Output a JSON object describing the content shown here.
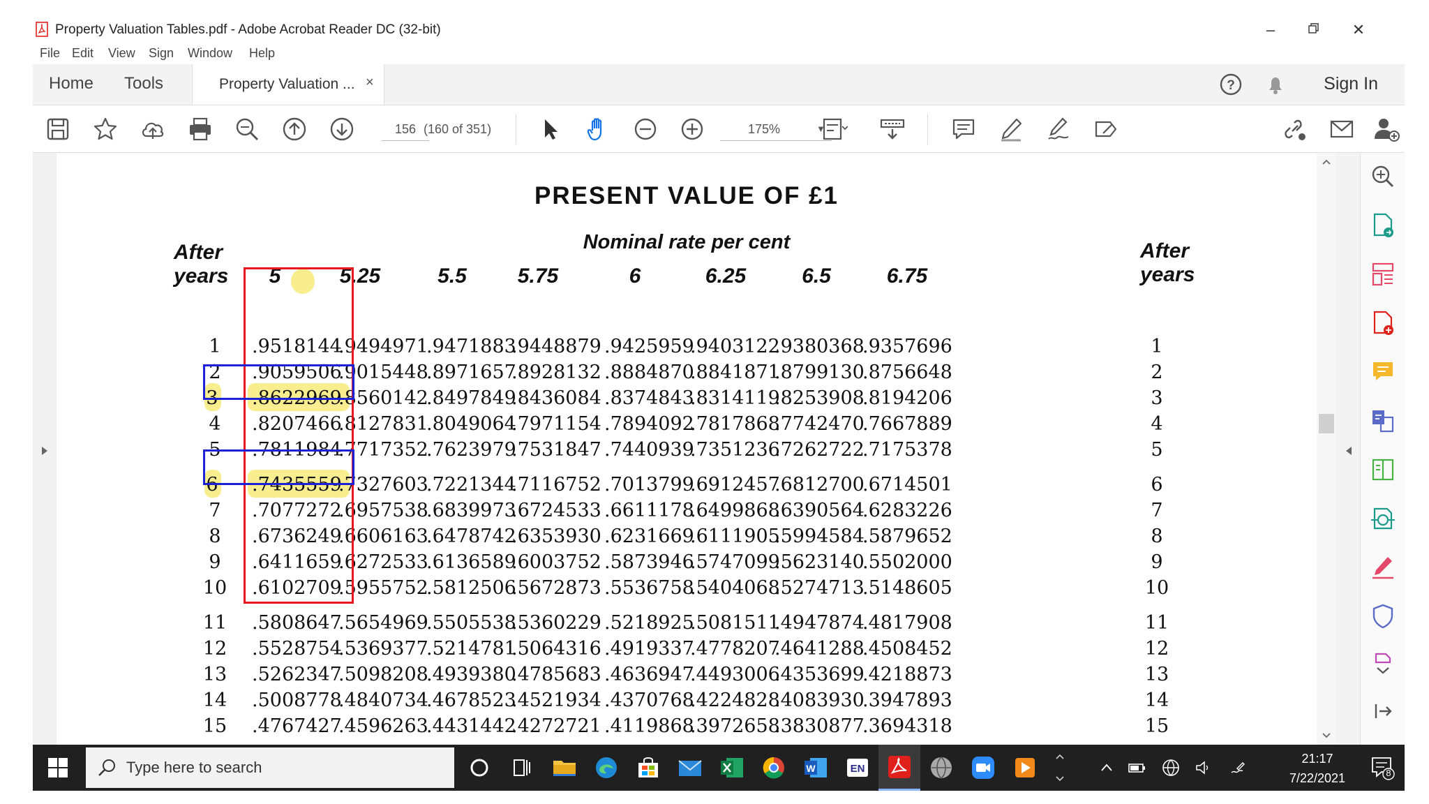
{
  "window": {
    "title": "Property Valuation Tables.pdf - Adobe Acrobat Reader DC (32-bit)",
    "controls": [
      "minimize",
      "restore",
      "close"
    ]
  },
  "menu": [
    "File",
    "Edit",
    "View",
    "Sign",
    "Window",
    "Help"
  ],
  "tabs": {
    "home": "Home",
    "tools": "Tools",
    "document": "Property Valuation ...",
    "close_symbol": "×",
    "sign_in": "Sign In"
  },
  "toolbar": {
    "page_number": "156",
    "page_of": "(160 of 351)",
    "zoom": "175%"
  },
  "document": {
    "title": "PRESENT VALUE OF £1",
    "subtitle": "Nominal rate per cent",
    "after_years_left": [
      "After",
      "years"
    ],
    "after_years_right": [
      "After",
      "years"
    ],
    "rates": [
      "5",
      "5.25",
      "5.5",
      "5.75",
      "6",
      "6.25",
      "6.5",
      "6.75"
    ],
    "rows": [
      {
        "year": "1",
        "values": [
          ".9518144",
          ".9494971",
          ".9471883",
          ".9448879",
          ".9425959",
          ".9403122",
          ".9380368",
          ".9357696"
        ]
      },
      {
        "year": "2",
        "values": [
          ".9059506",
          ".9015448",
          ".8971657",
          ".8928132",
          ".8884870",
          ".8841871",
          ".8799130",
          ".8756648"
        ]
      },
      {
        "year": "3",
        "values": [
          ".8622969",
          ".8560142",
          ".8497849",
          ".8436084",
          ".8374843",
          ".8314119",
          ".8253908",
          ".8194206"
        ]
      },
      {
        "year": "4",
        "values": [
          ".8207466",
          ".8127831",
          ".8049064",
          ".7971154",
          ".7894092",
          ".7817868",
          ".7742470",
          ".7667889"
        ]
      },
      {
        "year": "5",
        "values": [
          ".7811984",
          ".7717352",
          ".7623979",
          ".7531847",
          ".7440939",
          ".7351236",
          ".7262722",
          ".7175378"
        ]
      },
      {
        "year": "6",
        "values": [
          ".7435559",
          ".7327603",
          ".7221344",
          ".7116752",
          ".7013799",
          ".6912457",
          ".6812700",
          ".6714501"
        ]
      },
      {
        "year": "7",
        "values": [
          ".7077272",
          ".6957538",
          ".6839973",
          ".6724533",
          ".6611178",
          ".6499868",
          ".6390564",
          ".6283226"
        ]
      },
      {
        "year": "8",
        "values": [
          ".6736249",
          ".6606163",
          ".6478742",
          ".6353930",
          ".6231669",
          ".6111905",
          ".5994584",
          ".5879652"
        ]
      },
      {
        "year": "9",
        "values": [
          ".6411659",
          ".6272533",
          ".6136589",
          ".6003752",
          ".5873946",
          ".5747099",
          ".5623140",
          ".5502000"
        ]
      },
      {
        "year": "10",
        "values": [
          ".6102709",
          ".5955752",
          ".5812506",
          ".5672873",
          ".5536758",
          ".5404068",
          ".5274713",
          ".5148605"
        ]
      },
      {
        "year": "11",
        "values": [
          ".5808647",
          ".5654969",
          ".5505538",
          ".5360229",
          ".5218925",
          ".5081511",
          ".4947874",
          ".4817908"
        ]
      },
      {
        "year": "12",
        "values": [
          ".5528754",
          ".5369377",
          ".5214781",
          ".5064316",
          ".4919337",
          ".4778207",
          ".4641288",
          ".4508452"
        ]
      },
      {
        "year": "13",
        "values": [
          ".5262347",
          ".5098208",
          ".4939380",
          ".4785683",
          ".4636947",
          ".4493006",
          ".4353699",
          ".4218873"
        ]
      },
      {
        "year": "14",
        "values": [
          ".5008778",
          ".4840734",
          ".4678523",
          ".4521934",
          ".4370768",
          ".4224828",
          ".4083930",
          ".3947893"
        ]
      },
      {
        "year": "15",
        "values": [
          ".4767427",
          ".4596263",
          ".4431442",
          ".4272721",
          ".4119868",
          ".3972658",
          ".3830877",
          ".3694318"
        ]
      }
    ],
    "annotations": {
      "highlight_color": "#f9ee8f",
      "red_box_color": "#e8181f",
      "blue_box_color": "#1d22d6"
    }
  },
  "taskbar": {
    "search_placeholder": "Type here to search",
    "time": "21:17",
    "date": "7/22/2021",
    "notification_count": "8",
    "lang": "EN"
  },
  "colors": {
    "acrobat_red": "#e0201b",
    "taskbar_bg": "#202020",
    "accent_blue": "#1473e6"
  }
}
